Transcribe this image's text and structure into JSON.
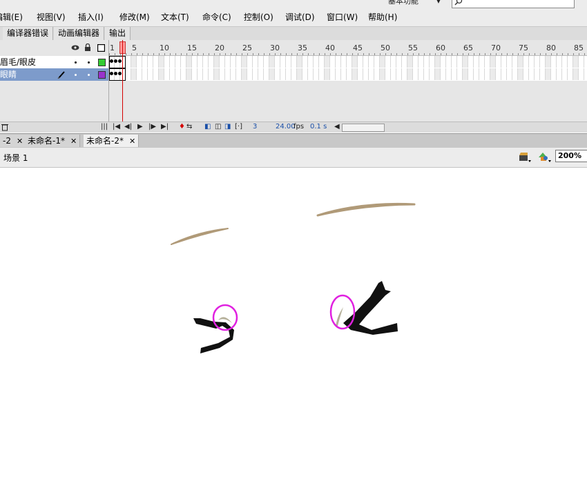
{
  "menu": [
    "编辑(E)",
    "视图(V)",
    "插入(I)",
    "修改(M)",
    "文本(T)",
    "命令(C)",
    "控制(O)",
    "调试(D)",
    "窗口(W)",
    "帮助(H)"
  ],
  "workspace": {
    "label": "基本功能"
  },
  "search": {
    "value": ""
  },
  "panel_tabs": [
    "编译器错误",
    "动画编辑器",
    "输出"
  ],
  "timeline": {
    "ruler": [
      "1",
      "5",
      "10",
      "15",
      "20",
      "25",
      "30",
      "35",
      "40",
      "45",
      "50",
      "55",
      "60",
      "65",
      "70",
      "75",
      "80",
      "85"
    ],
    "layers": [
      {
        "name": "眉毛/眼皮",
        "selected": false,
        "color": "#33cc33"
      },
      {
        "name": "眼睛",
        "selected": true,
        "color": "#9933cc"
      }
    ],
    "status": {
      "frame": "3",
      "fps": "24.00",
      "fps_unit": "fps",
      "time": "0.1 s"
    }
  },
  "doc_tabs": [
    {
      "label": "-2",
      "active": false
    },
    {
      "label": "未命名-1*",
      "active": false
    },
    {
      "label": "未命名-2*",
      "active": true
    }
  ],
  "editbar": {
    "scene": "场景 1",
    "zoom": "200%"
  },
  "colors": {
    "selected_layer": "#7d9bcb",
    "playhead": "#d40000",
    "eyebrow": "#b09a78",
    "highlight": "#e020e0"
  }
}
